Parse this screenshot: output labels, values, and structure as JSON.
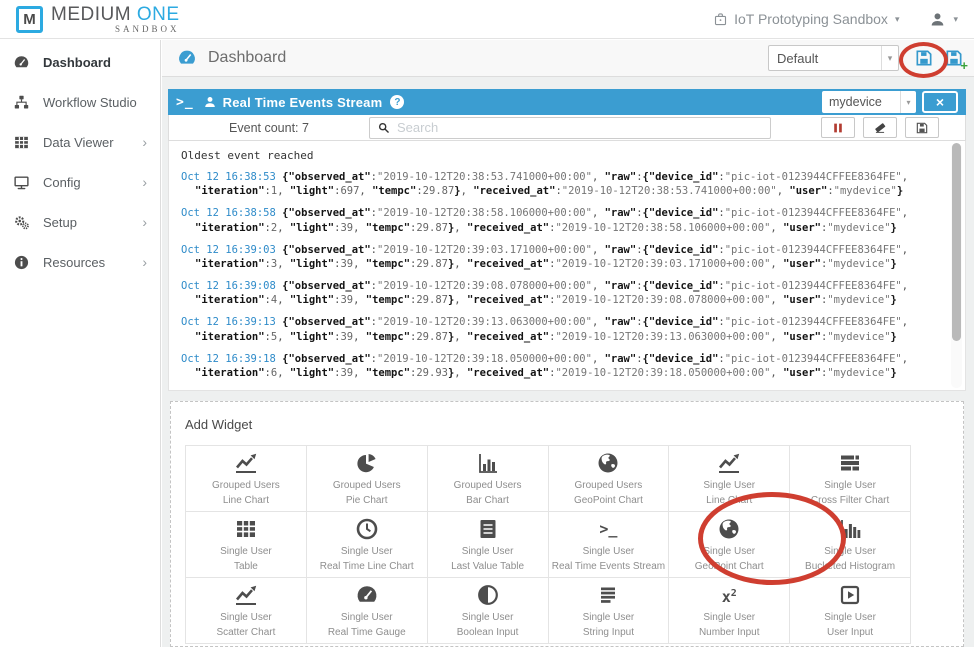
{
  "brand": {
    "mark": "M",
    "name_primary": "MEDIUM",
    "name_secondary": "ONE",
    "subtitle": "SANDBOX"
  },
  "top_bar": {
    "workspace_label": "IoT Prototyping Sandbox",
    "workspace_icon": "briefcase-icon",
    "user_icon": "user-icon"
  },
  "sidebar": {
    "items": [
      {
        "label": "Dashboard",
        "icon": "gauge-icon",
        "active": true,
        "has_submenu": false
      },
      {
        "label": "Workflow Studio",
        "icon": "sitemap-icon",
        "active": false,
        "has_submenu": false
      },
      {
        "label": "Data Viewer",
        "icon": "table-grid-icon",
        "active": false,
        "has_submenu": true
      },
      {
        "label": "Config",
        "icon": "monitor-icon",
        "active": false,
        "has_submenu": true
      },
      {
        "label": "Setup",
        "icon": "gears-icon",
        "active": false,
        "has_submenu": true
      },
      {
        "label": "Resources",
        "icon": "info-icon",
        "active": false,
        "has_submenu": true
      }
    ]
  },
  "page_header": {
    "title": "Dashboard",
    "dashboard_name": "Default"
  },
  "stream_widget": {
    "terminal_glyph": ">_",
    "title": "Real Time Events Stream",
    "help_glyph": "?",
    "device_selected": "mydevice",
    "close_glyph": "×",
    "event_count": "Event count: 7",
    "search_placeholder": "Search",
    "status_line": "Oldest event reached",
    "events": [
      {
        "time": "Oct 12 16:38:53",
        "observed_at": "2019-10-12T20:38:53.741000+00:00",
        "device_id": "pic-iot-0123944CFFEE8364FE",
        "iteration": 1,
        "light": 697,
        "tempc": 29.87,
        "received_at": "2019-10-12T20:38:53.741000+00:00",
        "user": "mydevice"
      },
      {
        "time": "Oct 12 16:38:58",
        "observed_at": "2019-10-12T20:38:58.106000+00:00",
        "device_id": "pic-iot-0123944CFFEE8364FE",
        "iteration": 2,
        "light": 39,
        "tempc": 29.87,
        "received_at": "2019-10-12T20:38:58.106000+00:00",
        "user": "mydevice"
      },
      {
        "time": "Oct 12 16:39:03",
        "observed_at": "2019-10-12T20:39:03.171000+00:00",
        "device_id": "pic-iot-0123944CFFEE8364FE",
        "iteration": 3,
        "light": 39,
        "tempc": 29.87,
        "received_at": "2019-10-12T20:39:03.171000+00:00",
        "user": "mydevice"
      },
      {
        "time": "Oct 12 16:39:08",
        "observed_at": "2019-10-12T20:39:08.078000+00:00",
        "device_id": "pic-iot-0123944CFFEE8364FE",
        "iteration": 4,
        "light": 39,
        "tempc": 29.87,
        "received_at": "2019-10-12T20:39:08.078000+00:00",
        "user": "mydevice"
      },
      {
        "time": "Oct 12 16:39:13",
        "observed_at": "2019-10-12T20:39:13.063000+00:00",
        "device_id": "pic-iot-0123944CFFEE8364FE",
        "iteration": 5,
        "light": 39,
        "tempc": 29.87,
        "received_at": "2019-10-12T20:39:13.063000+00:00",
        "user": "mydevice"
      },
      {
        "time": "Oct 12 16:39:18",
        "observed_at": "2019-10-12T20:39:18.050000+00:00",
        "device_id": "pic-iot-0123944CFFEE8364FE",
        "iteration": 6,
        "light": 39,
        "tempc": 29.93,
        "received_at": "2019-10-12T20:39:18.050000+00:00",
        "user": "mydevice"
      }
    ]
  },
  "add_widget": {
    "title": "Add Widget",
    "widgets": [
      {
        "line1": "Grouped Users",
        "line2": "Line Chart",
        "icon": "line-chart-icon",
        "highlighted": false
      },
      {
        "line1": "Grouped Users",
        "line2": "Pie Chart",
        "icon": "pie-chart-icon",
        "highlighted": false
      },
      {
        "line1": "Grouped Users",
        "line2": "Bar Chart",
        "icon": "bar-chart-icon",
        "highlighted": false
      },
      {
        "line1": "Grouped Users",
        "line2": "GeoPoint Chart",
        "icon": "globe-icon",
        "highlighted": false
      },
      {
        "line1": "Single User",
        "line2": "Line Chart",
        "icon": "line-chart-icon",
        "highlighted": false
      },
      {
        "line1": "Single User",
        "line2": "Cross Filter Chart",
        "icon": "cross-filter-icon",
        "highlighted": false
      },
      {
        "line1": "Single User",
        "line2": "Table",
        "icon": "table-grid-icon",
        "highlighted": false
      },
      {
        "line1": "Single User",
        "line2": "Real Time Line Chart",
        "icon": "clock-icon",
        "highlighted": false
      },
      {
        "line1": "Single User",
        "line2": "Last Value Table",
        "icon": "list-icon",
        "highlighted": false
      },
      {
        "line1": "Single User",
        "line2": "Real Time Events Stream",
        "icon": "terminal-icon",
        "highlighted": true
      },
      {
        "line1": "Single User",
        "line2": "GeoPoint Chart",
        "icon": "globe-icon",
        "highlighted": false
      },
      {
        "line1": "Single User",
        "line2": "Bucketed Histogram",
        "icon": "histogram-icon",
        "highlighted": false
      },
      {
        "line1": "Single User",
        "line2": "Scatter Chart",
        "icon": "scatter-chart-icon",
        "highlighted": false
      },
      {
        "line1": "Single User",
        "line2": "Real Time Gauge",
        "icon": "gauge-icon",
        "highlighted": false
      },
      {
        "line1": "Single User",
        "line2": "Boolean Input",
        "icon": "boolean-icon",
        "highlighted": false
      },
      {
        "line1": "Single User",
        "line2": "String Input",
        "icon": "string-input-icon",
        "highlighted": false
      },
      {
        "line1": "Single User",
        "line2": "Number Input",
        "icon": "number-input-icon",
        "highlighted": false
      },
      {
        "line1": "Single User",
        "line2": "User Input",
        "icon": "user-input-icon",
        "highlighted": false
      }
    ]
  },
  "colors": {
    "accent_blue": "#3b9dd1",
    "brand_blue": "#2caae1",
    "timestamp_blue": "#2e8bc9",
    "annotation_red": "#cf3e30",
    "pause_red": "#b23c31",
    "save_green_plus": "#3aa23a"
  }
}
